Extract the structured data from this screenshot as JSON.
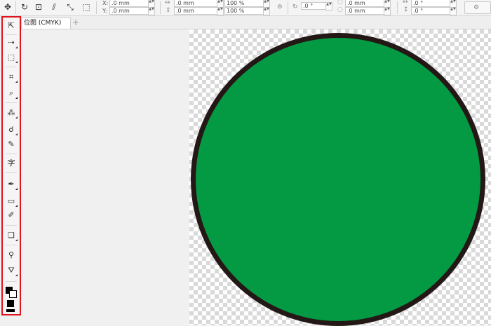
{
  "propbar": {
    "x_label": "X:",
    "y_label": "Y:",
    "x_value": ".0 mm",
    "y_value": ".0 mm",
    "width_value": ".0 mm",
    "height_value": ".0 mm",
    "scale_x": "100 %",
    "scale_y": "100 %",
    "rotation_value": ".0 °",
    "pos2_x": ".0 mm",
    "pos2_y": ".0 mm",
    "skew_x": ".0 °",
    "skew_y": ".0 °"
  },
  "document": {
    "tab_label": "位图 (CMYK)",
    "add_tab_glyph": "+"
  },
  "toolbox": {
    "text_tool_glyph": "字",
    "highlight_color": "#e0141e"
  },
  "canvas": {
    "circle_fill": "#049a43",
    "circle_outline": "#231815"
  }
}
